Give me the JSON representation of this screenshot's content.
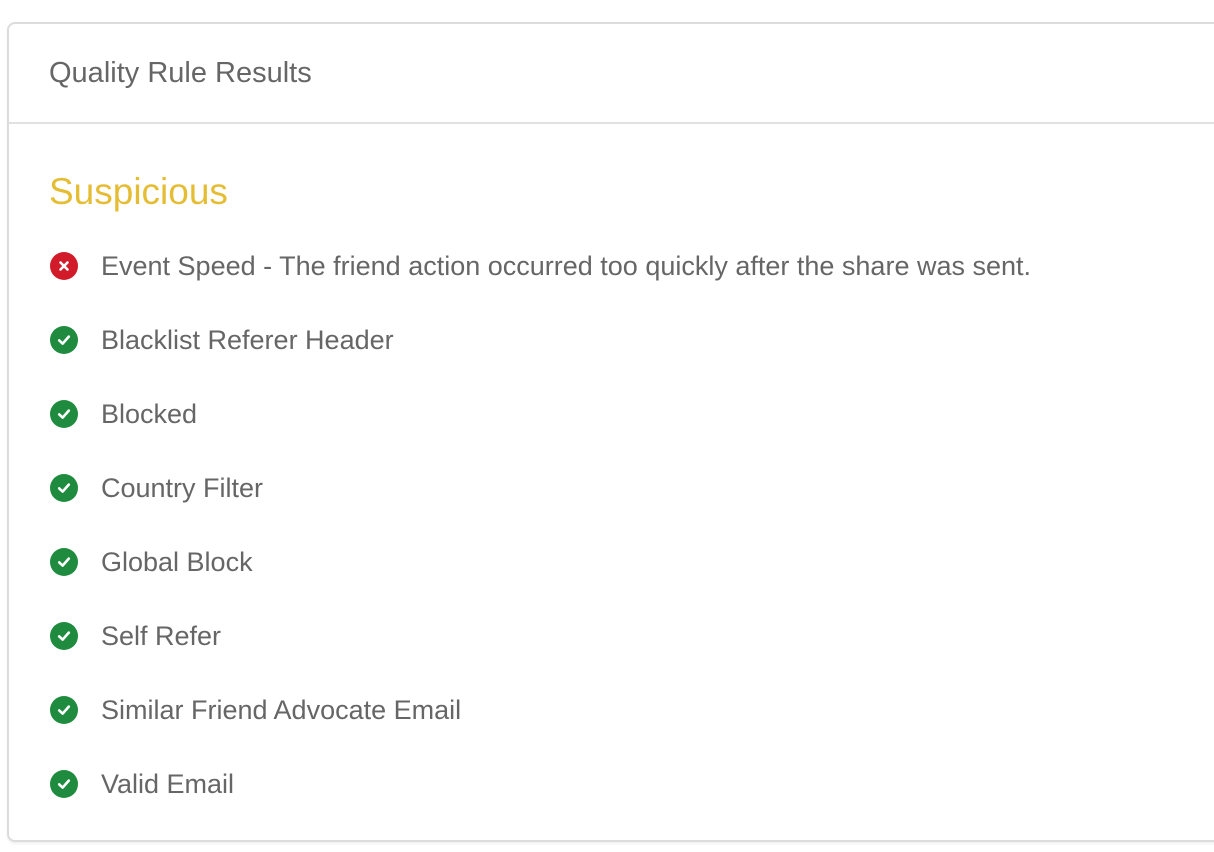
{
  "panel": {
    "title": "Quality Rule Results"
  },
  "result": {
    "status": "Suspicious",
    "status_color": "#e5bd35"
  },
  "colors": {
    "fail": "#d11a2a",
    "pass": "#1f8b3e"
  },
  "rules": [
    {
      "status": "fail",
      "icon": "error-icon",
      "label": "Event Speed - The friend action occurred too quickly after the share was sent."
    },
    {
      "status": "pass",
      "icon": "check-icon",
      "label": "Blacklist Referer Header"
    },
    {
      "status": "pass",
      "icon": "check-icon",
      "label": "Blocked"
    },
    {
      "status": "pass",
      "icon": "check-icon",
      "label": "Country Filter"
    },
    {
      "status": "pass",
      "icon": "check-icon",
      "label": "Global Block"
    },
    {
      "status": "pass",
      "icon": "check-icon",
      "label": "Self Refer"
    },
    {
      "status": "pass",
      "icon": "check-icon",
      "label": "Similar Friend Advocate Email"
    },
    {
      "status": "pass",
      "icon": "check-icon",
      "label": "Valid Email"
    }
  ]
}
